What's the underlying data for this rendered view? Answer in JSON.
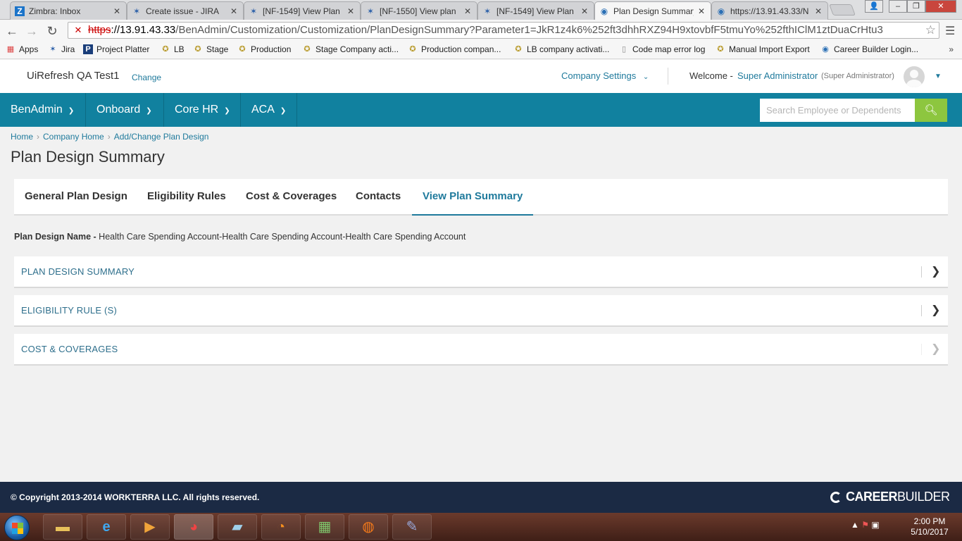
{
  "browser": {
    "tabs": [
      {
        "title": "Zimbra: Inbox",
        "icon": "Z"
      },
      {
        "title": "Create issue - JIRA",
        "icon": "jira"
      },
      {
        "title": "[NF-1549] View Plan",
        "icon": "jira"
      },
      {
        "title": "[NF-1550] View plan",
        "icon": "jira"
      },
      {
        "title": "[NF-1549] View Plan",
        "icon": "jira"
      },
      {
        "title": "Plan Design Summary",
        "icon": "ie"
      },
      {
        "title": "https://13.91.43.33/N",
        "icon": "ie"
      }
    ],
    "url_scheme": "https",
    "url_host": "://13.91.43.33",
    "url_path": "/BenAdmin/Customization/Customization/PlanDesignSummary?Parameter1=JkR1z4k6%252ft3dhhRXZ94H9xtovbfF5tmuYo%252fthIClM1ztDuaCrHtu3",
    "bookmarks": [
      "Apps",
      "Jira",
      "Project Platter",
      "LB",
      "Stage",
      "Production",
      "Stage Company acti...",
      "Production compan...",
      "LB company activati...",
      "Code map error log",
      "Manual Import Export",
      "Career Builder Login..."
    ],
    "bookmarks_more": "»"
  },
  "header": {
    "company": "UiRefresh QA Test1",
    "change": "Change",
    "company_settings": "Company Settings",
    "welcome": "Welcome -",
    "user_name": "Super Administrator",
    "user_role": "(Super Administrator)"
  },
  "nav": {
    "items": [
      "BenAdmin",
      "Onboard",
      "Core HR",
      "ACA"
    ],
    "search_placeholder": "Search Employee or Dependents"
  },
  "breadcrumb": [
    "Home",
    "Company Home",
    "Add/Change Plan Design"
  ],
  "page_title": "Plan Design Summary",
  "tabs": [
    "General Plan Design",
    "Eligibility Rules",
    "Cost & Coverages",
    "Contacts",
    "View Plan Summary"
  ],
  "active_tab": "View Plan Summary",
  "plan_design": {
    "label": "Plan Design Name -",
    "value": " Health Care Spending Account-Health Care Spending Account-Health Care Spending Account"
  },
  "sections": [
    "PLAN DESIGN SUMMARY",
    "ELIGIBILITY RULE (S)",
    "COST & COVERAGES"
  ],
  "footer": {
    "copyright": "© Copyright 2013-2014 WORKTERRA LLC. All rights reserved.",
    "brand_bold": "CAREER",
    "brand_thin": "BUILDER"
  },
  "taskbar": {
    "time": "2:00 PM",
    "date": "5/10/2017"
  },
  "colors": {
    "nav_bg": "#11819f",
    "accent": "#1f7a9c",
    "search_btn": "#8dc63f",
    "footer_bg": "#1b2a44"
  }
}
